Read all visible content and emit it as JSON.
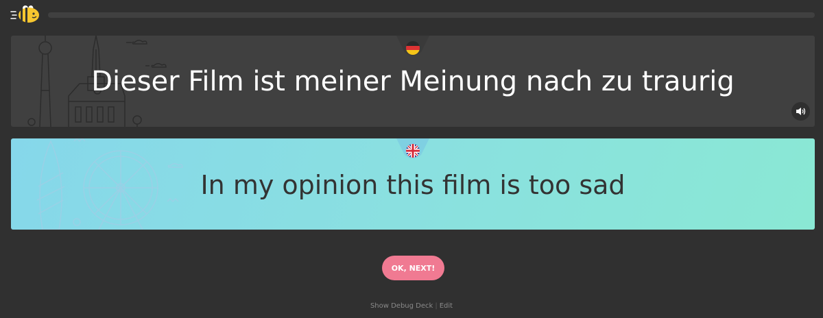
{
  "header": {
    "logo_icon": "bee-icon",
    "progress_fraction": 0
  },
  "source": {
    "flag_icon": "germany-flag-icon",
    "sentence": "Dieser Film ist meiner Meinung nach zu traurig",
    "audio_icon": "speaker-icon"
  },
  "target": {
    "flag_icon": "uk-flag-icon",
    "sentence": "In my opinion this film is too sad"
  },
  "actions": {
    "next_label": "OK, NEXT!"
  },
  "footer": {
    "debug_label": "Show Debug Deck",
    "separator": "|",
    "edit_label": "Edit"
  },
  "colors": {
    "background": "#303030",
    "source_card": "#404040",
    "target_gradient_start": "#86d7ea",
    "target_gradient_end": "#8ae8d4",
    "next_button": "#f07a92"
  }
}
